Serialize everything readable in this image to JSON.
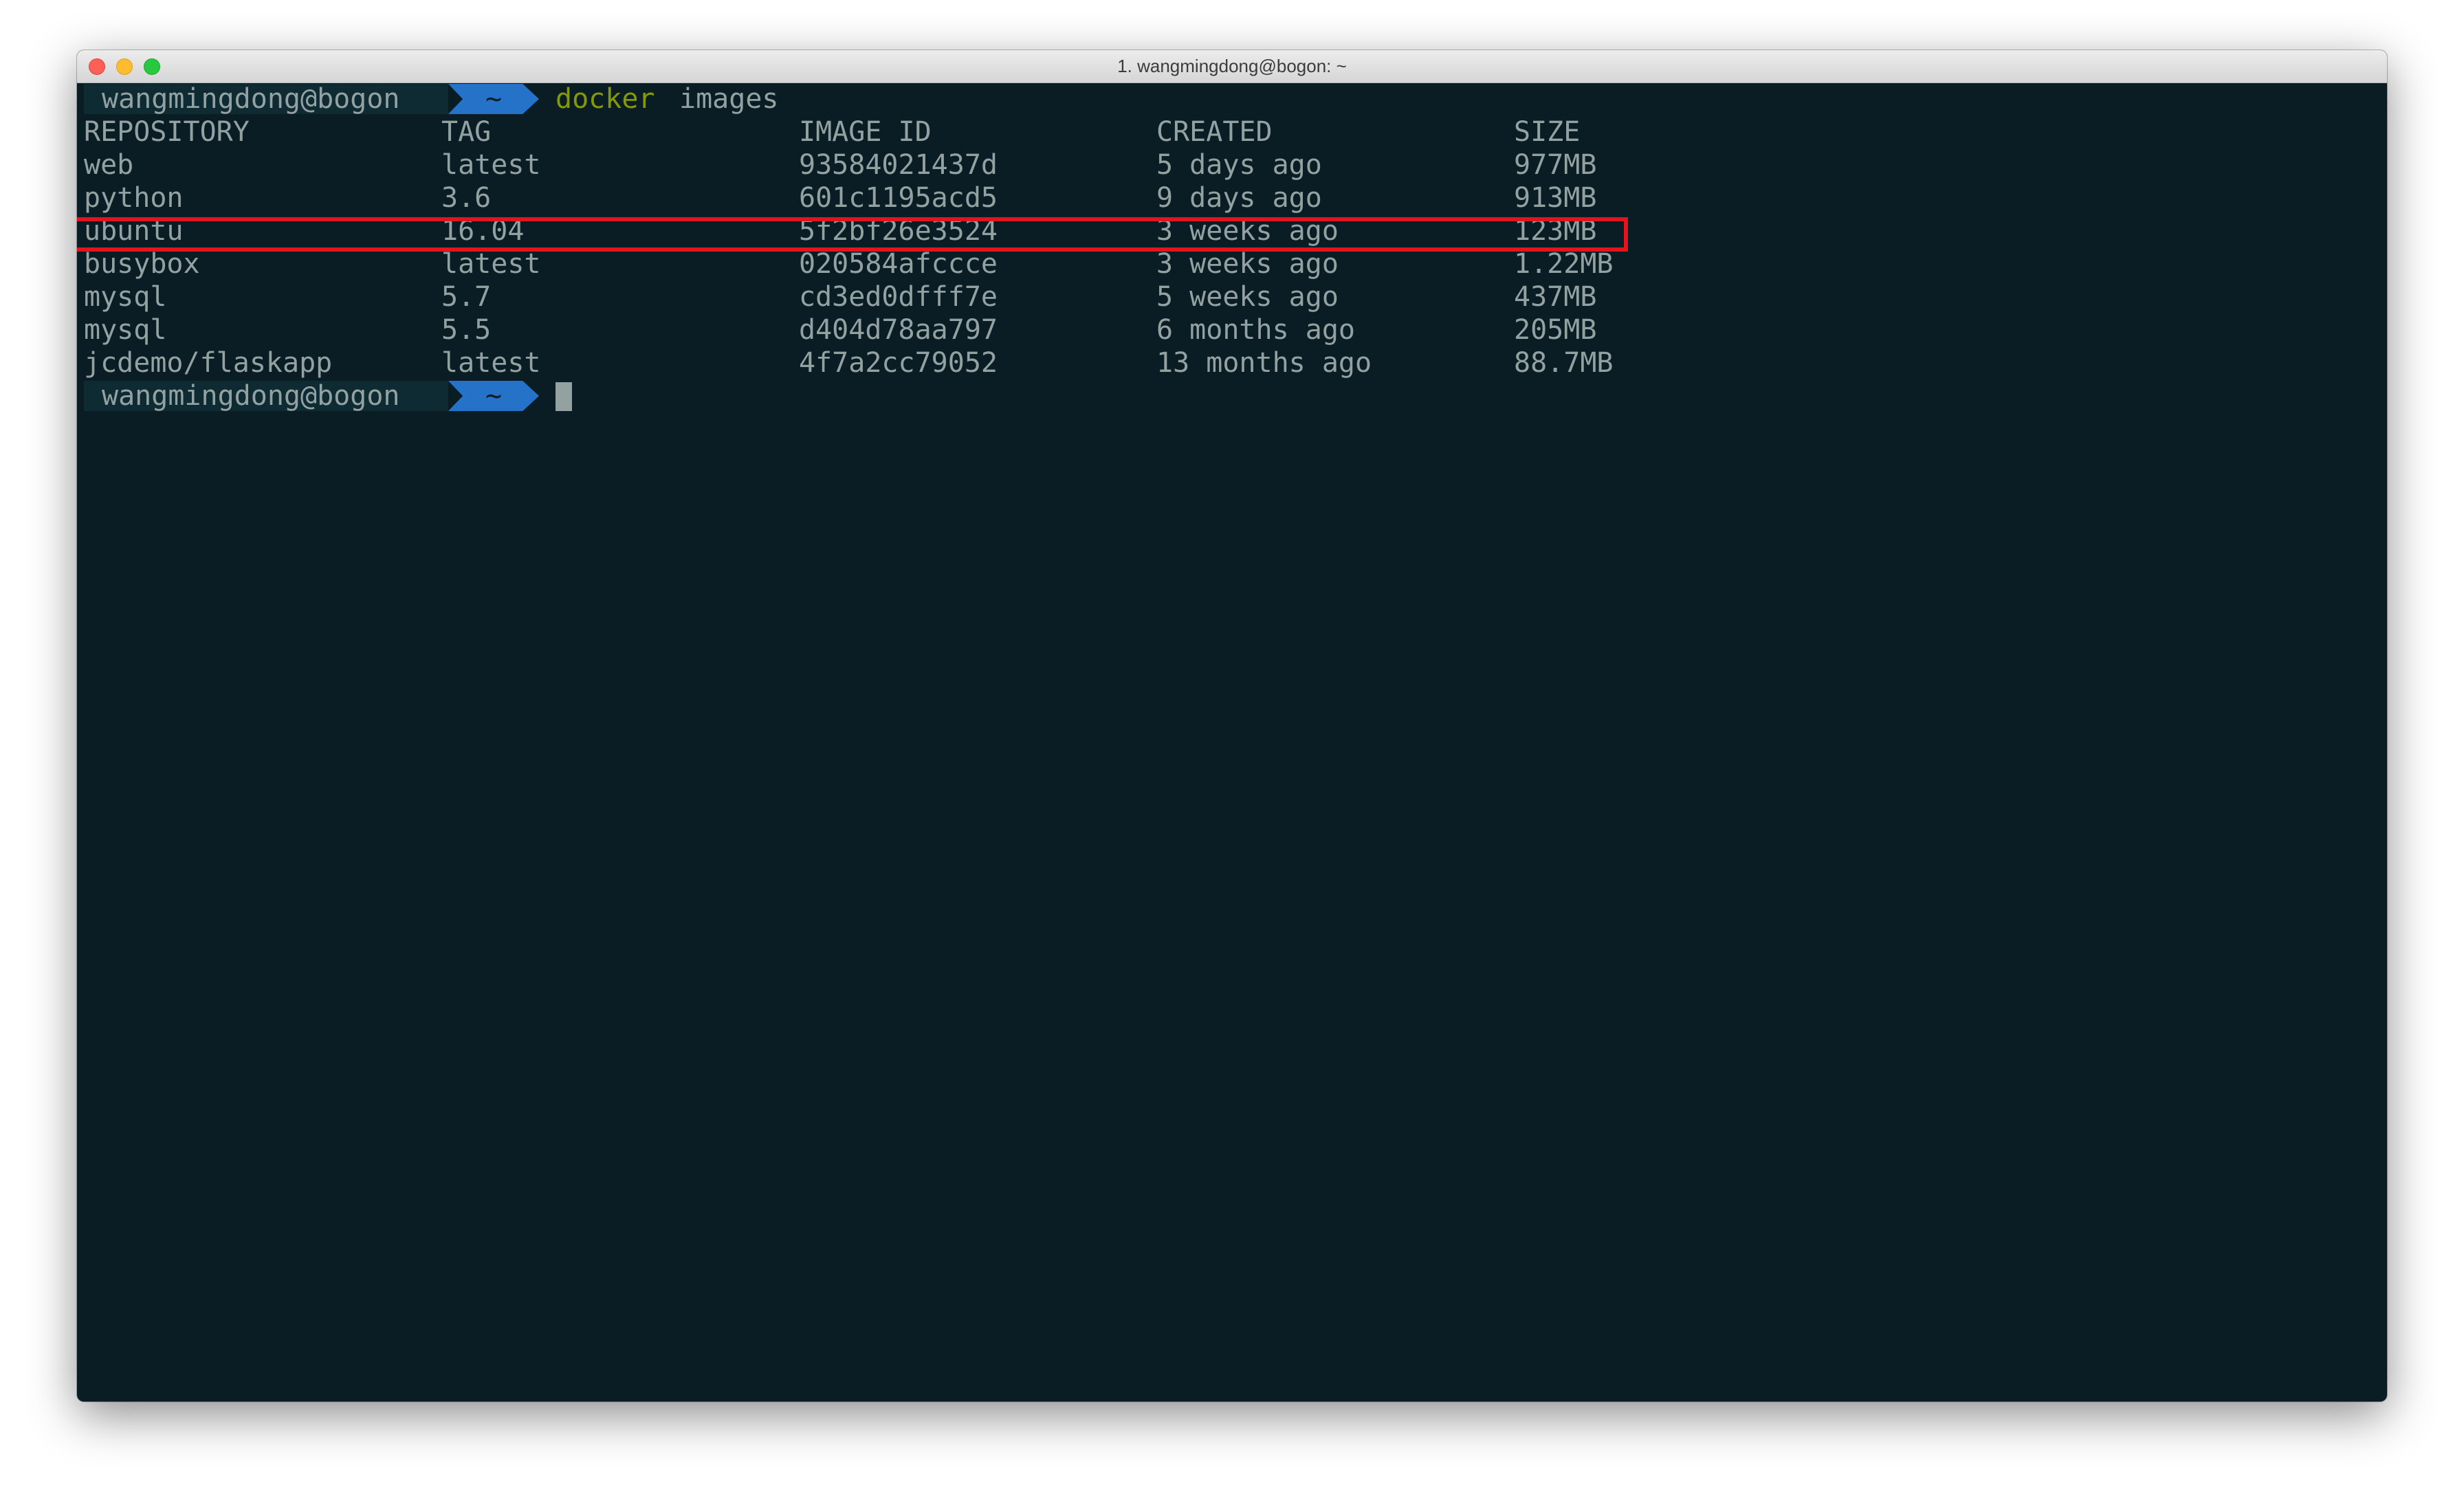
{
  "window": {
    "title": "1. wangmingdong@bogon: ~"
  },
  "prompt": {
    "user": "wangmingdong@bogon",
    "dir": "~"
  },
  "command": {
    "name": "docker",
    "args": "images"
  },
  "table": {
    "headers": [
      "REPOSITORY",
      "TAG",
      "IMAGE ID",
      "CREATED",
      "SIZE"
    ],
    "rows": [
      [
        "web",
        "latest",
        "93584021437d",
        "5 days ago",
        "977MB"
      ],
      [
        "python",
        "3.6",
        "601c1195acd5",
        "9 days ago",
        "913MB"
      ],
      [
        "ubuntu",
        "16.04",
        "5f2bf26e3524",
        "3 weeks ago",
        "123MB"
      ],
      [
        "busybox",
        "latest",
        "020584afccce",
        "3 weeks ago",
        "1.22MB"
      ],
      [
        "mysql",
        "5.7",
        "cd3ed0dfff7e",
        "5 weeks ago",
        "437MB"
      ],
      [
        "mysql",
        "5.5",
        "d404d78aa797",
        "6 months ago",
        "205MB"
      ],
      [
        "jcdemo/flaskapp",
        "latest",
        "4f7a2cc79052",
        "13 months ago",
        "88.7MB"
      ]
    ],
    "highlighted_row": "ubuntu"
  },
  "colors": {
    "terminal_background": "#0a1d25",
    "text": "#93a1a1",
    "command": "#859900",
    "prompt_dir_segment": "#2473c9",
    "highlight_box": "#e3141e"
  }
}
